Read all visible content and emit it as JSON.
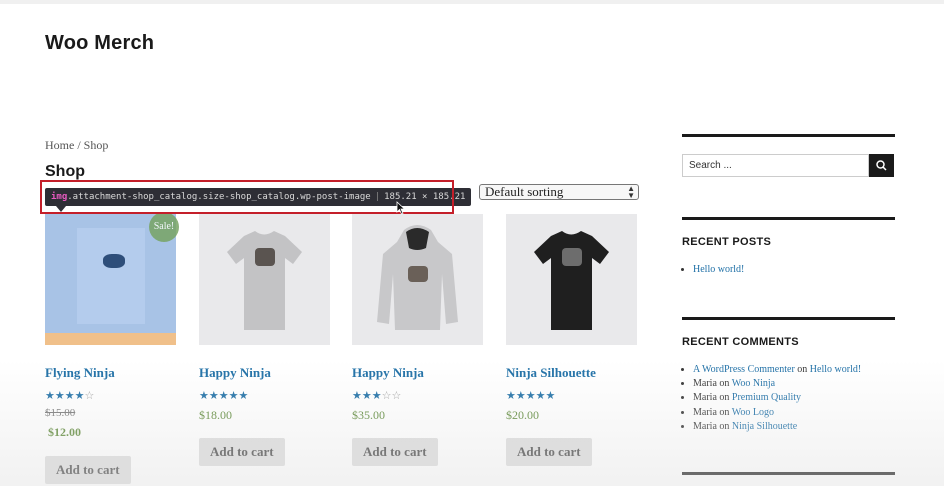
{
  "site": {
    "title": "Woo Merch"
  },
  "breadcrumb": "Home / Shop",
  "page_title": "Shop",
  "sorting": {
    "selected": "Default sorting"
  },
  "devtools_tooltip": {
    "tag": "img",
    "selector": ".attachment-shop_catalog.size-shop_catalog.wp-post-image",
    "dimensions": "185.21 × 185.21"
  },
  "products": [
    {
      "name": "Flying Ninja",
      "rating": 4,
      "old_price": "$15.00",
      "price": "$12.00",
      "sale_badge": "Sale!",
      "button": "Add to cart"
    },
    {
      "name": "Happy Ninja",
      "rating": 5,
      "price": "$18.00",
      "button": "Add to cart"
    },
    {
      "name": "Happy Ninja",
      "rating": 3,
      "price": "$35.00",
      "button": "Add to cart"
    },
    {
      "name": "Ninja Silhouette",
      "rating": 5,
      "price": "$20.00",
      "button": "Add to cart"
    }
  ],
  "sidebar": {
    "search_placeholder": "Search ...",
    "recent_posts": {
      "title": "RECENT POSTS",
      "items": [
        "Hello world!"
      ]
    },
    "recent_comments": {
      "title": "RECENT COMMENTS",
      "items": [
        {
          "author": "A WordPress Commenter",
          "on": "on",
          "post": "Hello world!"
        },
        {
          "author": "Maria",
          "on": "on",
          "post": "Woo Ninja"
        },
        {
          "author": "Maria",
          "on": "on",
          "post": "Premium Quality"
        },
        {
          "author": "Maria",
          "on": "on",
          "post": "Woo Logo"
        },
        {
          "author": "Maria",
          "on": "on",
          "post": "Ninja Silhouette"
        }
      ]
    }
  },
  "colors": {
    "link": "#1e6fa6",
    "price": "#5f8a3a",
    "sale": "#77a464",
    "highlight": "#c41f2a"
  }
}
